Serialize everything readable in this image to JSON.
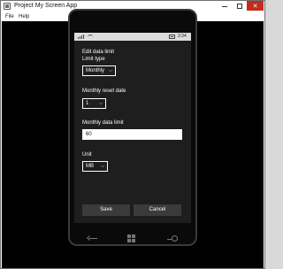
{
  "window": {
    "title": "Project My Screen App",
    "controls": {
      "minimize": "minimize-icon",
      "maximize": "maximize-icon",
      "close": "✕"
    }
  },
  "menu": {
    "items": [
      "File",
      "Help"
    ]
  },
  "phone": {
    "status_bar": {
      "time": "3:34",
      "icons": [
        "signal-icon",
        "wifi-icon",
        "battery-icon"
      ]
    },
    "form": {
      "title": "Edit data limit",
      "limit_type": {
        "label": "Limit type",
        "value": "Monthly"
      },
      "reset_date": {
        "label": "Monthly reset date",
        "value": "1"
      },
      "data_limit": {
        "label": "Monthly data limit",
        "value": "60"
      },
      "unit": {
        "label": "Unit",
        "value": "MB"
      }
    },
    "buttons": {
      "save": "Save",
      "cancel": "Cancel"
    },
    "hardware_buttons": [
      "back-icon",
      "start-icon",
      "search-icon"
    ]
  },
  "colors": {
    "window_bg": "#ffffff",
    "content_bg": "#000000",
    "screen_bg": "#1e1e1e",
    "status_bar_bg": "#dcdcdc",
    "button_bg": "#3b3b3b",
    "close_red": "#c42b1c"
  }
}
